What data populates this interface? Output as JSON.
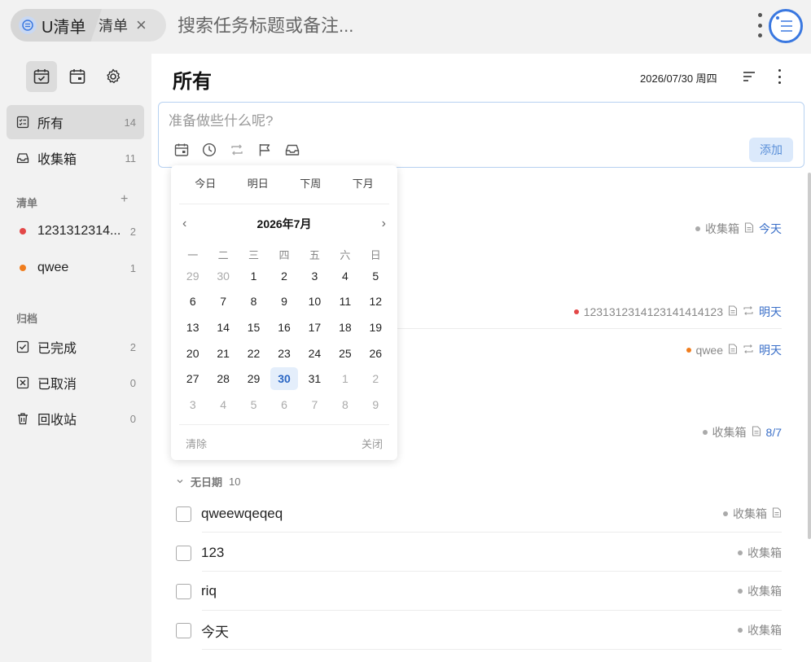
{
  "topbar": {
    "app_tab_label": "U清单",
    "list_tab_label": "清单",
    "search_placeholder": "搜索任务标题或备注..."
  },
  "sidebar": {
    "nav": [
      {
        "label": "所有",
        "count": "14"
      },
      {
        "label": "收集箱",
        "count": "11"
      }
    ],
    "lists_section": "清单",
    "lists": [
      {
        "label": "1231312314...",
        "count": "2",
        "color": "#e34848"
      },
      {
        "label": "qwee",
        "count": "1",
        "color": "#f07d1e"
      }
    ],
    "archive_section": "归档",
    "archive": [
      {
        "label": "已完成",
        "count": "2"
      },
      {
        "label": "已取消",
        "count": "0"
      },
      {
        "label": "回收站",
        "count": "0"
      }
    ]
  },
  "main": {
    "title": "所有",
    "date": "2026/07/30 周四",
    "composer_placeholder": "准备做些什么呢?",
    "add_label": "添加",
    "rows": [
      {
        "list": "收集箱",
        "due": "今天"
      },
      {
        "list": "1231312314123141414123",
        "due": "明天",
        "dot": "#e34848"
      },
      {
        "list": "qwee",
        "due": "明天",
        "dot": "#f07d1e"
      },
      {
        "list": "收集箱",
        "due": "8/7"
      }
    ],
    "group": {
      "label": "无日期",
      "count": "10"
    },
    "tasks": [
      {
        "title": "qweewqeqeq",
        "list": "收集箱"
      },
      {
        "title": "123",
        "list": "收集箱"
      },
      {
        "title": "riq",
        "list": "收集箱"
      },
      {
        "title": "今天",
        "list": "收集箱"
      }
    ]
  },
  "datepicker": {
    "quick": [
      "今日",
      "明日",
      "下周",
      "下月"
    ],
    "month_title": "2026年7月",
    "prev": "‹",
    "next": "›",
    "weekdays": [
      "一",
      "二",
      "三",
      "四",
      "五",
      "六",
      "日"
    ],
    "days": [
      {
        "d": "29",
        "m": true
      },
      {
        "d": "30",
        "m": true
      },
      {
        "d": "1"
      },
      {
        "d": "2"
      },
      {
        "d": "3"
      },
      {
        "d": "4"
      },
      {
        "d": "5"
      },
      {
        "d": "6"
      },
      {
        "d": "7"
      },
      {
        "d": "8"
      },
      {
        "d": "9"
      },
      {
        "d": "10"
      },
      {
        "d": "11"
      },
      {
        "d": "12"
      },
      {
        "d": "13"
      },
      {
        "d": "14"
      },
      {
        "d": "15"
      },
      {
        "d": "16"
      },
      {
        "d": "17"
      },
      {
        "d": "18"
      },
      {
        "d": "19"
      },
      {
        "d": "20"
      },
      {
        "d": "21"
      },
      {
        "d": "22"
      },
      {
        "d": "23"
      },
      {
        "d": "24"
      },
      {
        "d": "25"
      },
      {
        "d": "26"
      },
      {
        "d": "27"
      },
      {
        "d": "28"
      },
      {
        "d": "29"
      },
      {
        "d": "30",
        "today": true
      },
      {
        "d": "31"
      },
      {
        "d": "1",
        "m": true
      },
      {
        "d": "2",
        "m": true
      },
      {
        "d": "3",
        "m": true
      },
      {
        "d": "4",
        "m": true
      },
      {
        "d": "5",
        "m": true
      },
      {
        "d": "6",
        "m": true
      },
      {
        "d": "7",
        "m": true
      },
      {
        "d": "8",
        "m": true
      },
      {
        "d": "9",
        "m": true
      }
    ],
    "clear_label": "清除",
    "close_label": "关闭"
  },
  "colors": {
    "accent": "#3a78e0",
    "due": "#3a6fc8"
  }
}
